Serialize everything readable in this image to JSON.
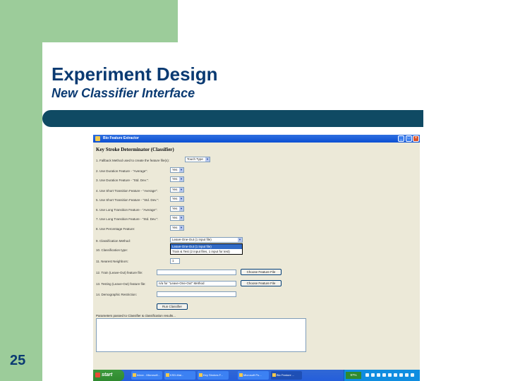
{
  "slide": {
    "title": "Experiment Design",
    "subtitle": "New Classifier Interface",
    "number": "25"
  },
  "window": {
    "title": "Bio Feature Extractor",
    "minimize": "_",
    "maximize": "□",
    "close": "×"
  },
  "form": {
    "heading": "Key Stroke Determinator (Classifier)",
    "rows": [
      {
        "label": "1. Fallback Method used to create the feature file(s):",
        "value": "Touch Type"
      },
      {
        "label": "2. Use Duration Feature - \"Average\":",
        "value": "Yes"
      },
      {
        "label": "3. Use Duration Feature - \"Std. Dev.\":",
        "value": "Yes"
      },
      {
        "label": "4. Use Short Transition Feature - \"Average\":",
        "value": "Yes"
      },
      {
        "label": "5. Use Short Transition Feature - \"Std. Dev.\":",
        "value": "Yes"
      },
      {
        "label": "6. Use Long Transition Feature - \"Average\":",
        "value": "Yes"
      },
      {
        "label": "7. Use Long Transition Feature - \"Std. Dev.\":",
        "value": "Yes"
      },
      {
        "label": "8. Use Percentage Feature:",
        "value": "Yes"
      }
    ],
    "classification_label": "9. Classification Method:",
    "classification_value": "Leave-One-Out (1 input file)",
    "dropdown_options": [
      "Leave-One-Out (1 input file)",
      "Train & Test (2 input files, 1 input for test)"
    ],
    "row10_label": "10. Classification type:",
    "row11_label": "11. Nearest Neighbors:",
    "row11_value": "1",
    "row12_label": "12. Train (Leave-Out) feature file:",
    "row12_value": "",
    "row13_label": "13. Testing (Leave-Out) feature file:",
    "row13_value": "n/a for \"Leave-One-Out\" Method",
    "row14_label": "14. Demographic Restriction:",
    "row14_value": "",
    "choose_button": "Choose Feature File",
    "run_button": "Run Classifier",
    "output_label": "Parameters passed to Classifier & classification results..."
  },
  "taskbar": {
    "start": "start",
    "tasks": [
      "Inbox - Microsoft...",
      "KSD-Mai...",
      "Key Strokes F...",
      "Microsoft Po...",
      "Bio Feature ..."
    ],
    "battery": "97%"
  }
}
